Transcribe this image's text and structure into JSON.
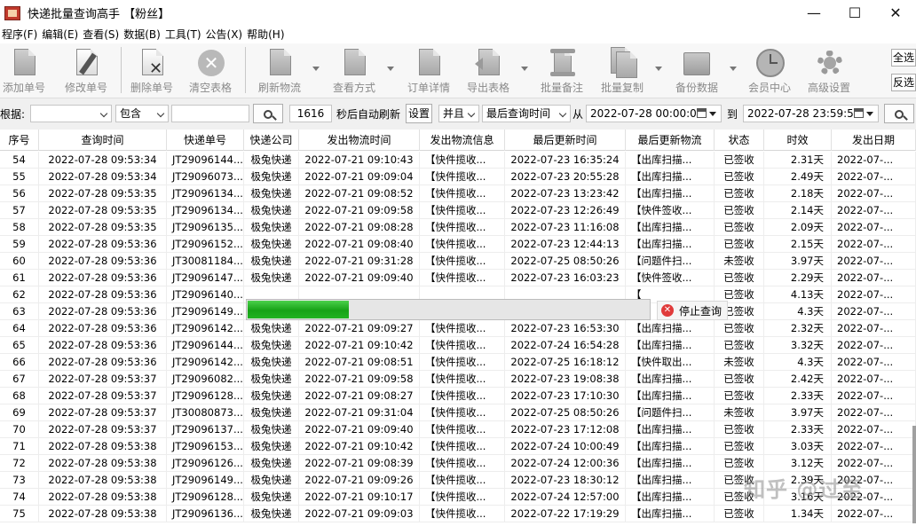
{
  "window": {
    "title": "快递批量查询高手 【粉丝】",
    "controls": {
      "minimize": "—",
      "maximize": "☐",
      "close": "✕"
    }
  },
  "menu": [
    "程序(F)",
    "编辑(E)",
    "查看(S)",
    "数据(B)",
    "工具(T)",
    "公告(X)",
    "帮助(H)"
  ],
  "toolbar": {
    "add": "添加单号",
    "edit": "修改单号",
    "delete": "删除单号",
    "clear": "清空表格",
    "refresh": "刷新物流",
    "view_mode": "查看方式",
    "order_detail": "订单详情",
    "export": "导出表格",
    "batch_note": "批量备注",
    "batch_copy": "批量复制",
    "backup": "备份数据",
    "member": "会员中心",
    "advanced": "高级设置",
    "select_all": "全选",
    "invert": "反选"
  },
  "filter": {
    "by_label": "根据:",
    "by_value": "",
    "match_value": "包含",
    "keyword": "",
    "interval": "1616",
    "auto_refresh_label": "秒后自动刷新",
    "settings_btn": "设置",
    "logic_value": "并且",
    "time_field_value": "最后查询时间",
    "from_label": "从",
    "from_value": "2022-07-28 00:00:00",
    "to_label": "到",
    "to_value": "2022-07-28 23:59:59"
  },
  "table": {
    "columns": [
      "序号",
      "查询时间",
      "快递单号",
      "快递公司",
      "发出物流时间",
      "发出物流信息",
      "最后更新时间",
      "最后更新物流",
      "状态",
      "时效",
      "发出日期"
    ],
    "rows": [
      [
        "54",
        "2022-07-28 09:53:34",
        "JT29096144...",
        "极兔快递",
        "2022-07-21 09:10:43",
        "【快件揽收...",
        "2022-07-23 16:35:24",
        "【出库扫描...",
        "已签收",
        "2.31天",
        "2022-07-..."
      ],
      [
        "55",
        "2022-07-28 09:53:34",
        "JT29096073...",
        "极兔快递",
        "2022-07-21 09:09:04",
        "【快件揽收...",
        "2022-07-23 20:55:28",
        "【出库扫描...",
        "已签收",
        "2.49天",
        "2022-07-..."
      ],
      [
        "56",
        "2022-07-28 09:53:35",
        "JT29096134...",
        "极兔快递",
        "2022-07-21 09:08:52",
        "【快件揽收...",
        "2022-07-23 13:23:42",
        "【出库扫描...",
        "已签收",
        "2.18天",
        "2022-07-..."
      ],
      [
        "57",
        "2022-07-28 09:53:35",
        "JT29096134...",
        "极兔快递",
        "2022-07-21 09:09:58",
        "【快件揽收...",
        "2022-07-23 12:26:49",
        "【快件签收...",
        "已签收",
        "2.14天",
        "2022-07-..."
      ],
      [
        "58",
        "2022-07-28 09:53:35",
        "JT29096135...",
        "极兔快递",
        "2022-07-21 09:08:28",
        "【快件揽收...",
        "2022-07-23 11:16:08",
        "【出库扫描...",
        "已签收",
        "2.09天",
        "2022-07-..."
      ],
      [
        "59",
        "2022-07-28 09:53:36",
        "JT29096152...",
        "极兔快递",
        "2022-07-21 09:08:40",
        "【快件揽收...",
        "2022-07-23 12:44:13",
        "【出库扫描...",
        "已签收",
        "2.15天",
        "2022-07-..."
      ],
      [
        "60",
        "2022-07-28 09:53:36",
        "JT30081184...",
        "极兔快递",
        "2022-07-21 09:31:28",
        "【快件揽收...",
        "2022-07-25 08:50:26",
        "【问题件扫...",
        "未签收",
        "3.97天",
        "2022-07-..."
      ],
      [
        "61",
        "2022-07-28 09:53:36",
        "JT29096147...",
        "极兔快递",
        "2022-07-21 09:09:40",
        "【快件揽收...",
        "2022-07-23 16:03:23",
        "【快件签收...",
        "已签收",
        "2.29天",
        "2022-07-..."
      ],
      [
        "62",
        "2022-07-28 09:53:36",
        "JT29096140...",
        "",
        "",
        "",
        "",
        "【",
        "已签收",
        "4.13天",
        "2022-07-..."
      ],
      [
        "63",
        "2022-07-28 09:53:36",
        "JT29096149...",
        "",
        "",
        "",
        "",
        "【",
        "已签收",
        "4.3天",
        "2022-07-..."
      ],
      [
        "64",
        "2022-07-28 09:53:36",
        "JT29096142...",
        "极兔快递",
        "2022-07-21 09:09:27",
        "【快件揽收...",
        "2022-07-23 16:53:30",
        "【出库扫描...",
        "已签收",
        "2.32天",
        "2022-07-..."
      ],
      [
        "65",
        "2022-07-28 09:53:36",
        "JT29096144...",
        "极兔快递",
        "2022-07-21 09:10:42",
        "【快件揽收...",
        "2022-07-24 16:54:28",
        "【出库扫描...",
        "已签收",
        "3.32天",
        "2022-07-..."
      ],
      [
        "66",
        "2022-07-28 09:53:36",
        "JT29096142...",
        "极兔快递",
        "2022-07-21 09:08:51",
        "【快件揽收...",
        "2022-07-25 16:18:12",
        "【快件取出...",
        "未签收",
        "4.3天",
        "2022-07-..."
      ],
      [
        "67",
        "2022-07-28 09:53:37",
        "JT29096082...",
        "极兔快递",
        "2022-07-21 09:09:58",
        "【快件揽收...",
        "2022-07-23 19:08:38",
        "【出库扫描...",
        "已签收",
        "2.42天",
        "2022-07-..."
      ],
      [
        "68",
        "2022-07-28 09:53:37",
        "JT29096128...",
        "极兔快递",
        "2022-07-21 09:08:27",
        "【快件揽收...",
        "2022-07-23 17:10:30",
        "【出库扫描...",
        "已签收",
        "2.33天",
        "2022-07-..."
      ],
      [
        "69",
        "2022-07-28 09:53:37",
        "JT30080873...",
        "极兔快递",
        "2022-07-21 09:31:04",
        "【快件揽收...",
        "2022-07-25 08:50:26",
        "【问题件扫...",
        "未签收",
        "3.97天",
        "2022-07-..."
      ],
      [
        "70",
        "2022-07-28 09:53:37",
        "JT29096137...",
        "极兔快递",
        "2022-07-21 09:09:40",
        "【快件揽收...",
        "2022-07-23 17:12:08",
        "【出库扫描...",
        "已签收",
        "2.33天",
        "2022-07-..."
      ],
      [
        "71",
        "2022-07-28 09:53:38",
        "JT29096153...",
        "极兔快递",
        "2022-07-21 09:10:42",
        "【快件揽收...",
        "2022-07-24 10:00:49",
        "【出库扫描...",
        "已签收",
        "3.03天",
        "2022-07-..."
      ],
      [
        "72",
        "2022-07-28 09:53:38",
        "JT29096126...",
        "极兔快递",
        "2022-07-21 09:08:39",
        "【快件揽收...",
        "2022-07-24 12:00:36",
        "【出库扫描...",
        "已签收",
        "3.12天",
        "2022-07-..."
      ],
      [
        "73",
        "2022-07-28 09:53:38",
        "JT29096149...",
        "极兔快递",
        "2022-07-21 09:09:26",
        "【快件揽收...",
        "2022-07-23 18:30:12",
        "【出库扫描...",
        "已签收",
        "2.39天",
        "2022-07-..."
      ],
      [
        "74",
        "2022-07-28 09:53:38",
        "JT29096128...",
        "极兔快递",
        "2022-07-21 09:10:17",
        "【快件揽收...",
        "2022-07-24 12:57:00",
        "【出库扫描...",
        "已签收",
        "3.16天",
        "2022-07-..."
      ],
      [
        "75",
        "2022-07-28 09:53:38",
        "JT29096136...",
        "极兔快递",
        "2022-07-21 09:09:03",
        "【快件揽收...",
        "2022-07-22 17:19:29",
        "【出库扫描...",
        "已签收",
        "1.34天",
        "2022-07-..."
      ]
    ]
  },
  "progress": {
    "fraction": 0.25,
    "stop_label": "停止查询"
  },
  "watermark": "知乎 @过至"
}
